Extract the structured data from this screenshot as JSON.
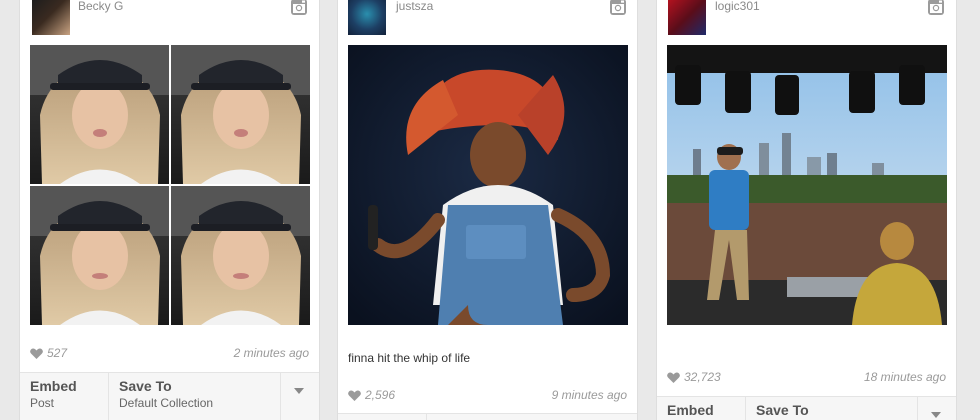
{
  "cards": [
    {
      "username": "Becky G",
      "caption": "",
      "likes": "527",
      "time": "2 minutes ago",
      "embed_label": "Embed",
      "embed_sub": "Post",
      "save_label": "Save To",
      "save_sub": "Default Collection"
    },
    {
      "username": "justsza",
      "caption": "finna hit the whip of life",
      "likes": "2,596",
      "time": "9 minutes ago"
    },
    {
      "username": "logic301",
      "caption": "",
      "likes": "32,723",
      "time": "18 minutes ago",
      "embed_label": "Embed",
      "save_label": "Save To"
    }
  ],
  "icons": {
    "instagram": "instagram-icon",
    "heart": "heart-icon",
    "dropdown": "chevron-down-icon"
  }
}
